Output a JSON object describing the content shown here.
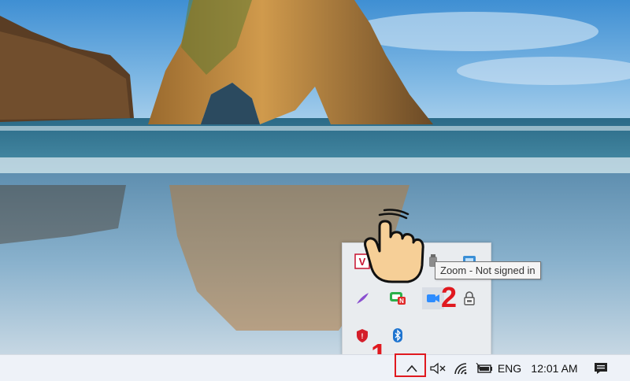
{
  "desktop": {
    "wallpaper": "beach-rock-arch"
  },
  "tooltip": {
    "text": "Zoom - Not signed in"
  },
  "annotations": {
    "step_1": "1",
    "step_2": "2",
    "highlight_color": "#e0191f"
  },
  "overflow_tray": {
    "icons": [
      {
        "name": "antivirus-v-icon"
      },
      {
        "name": "leaf-icon"
      },
      {
        "name": "usb-drive-icon"
      },
      {
        "name": "network-monitor-icon"
      },
      {
        "name": "feather-pen-icon"
      },
      {
        "name": "chat-app-icon"
      },
      {
        "name": "zoom-icon"
      },
      {
        "name": "lock-device-icon"
      },
      {
        "name": "shield-security-icon"
      },
      {
        "name": "bluetooth-icon"
      }
    ]
  },
  "taskbar": {
    "show_hidden_icons": "^",
    "language": "ENG",
    "clock": "12:01 AM"
  }
}
